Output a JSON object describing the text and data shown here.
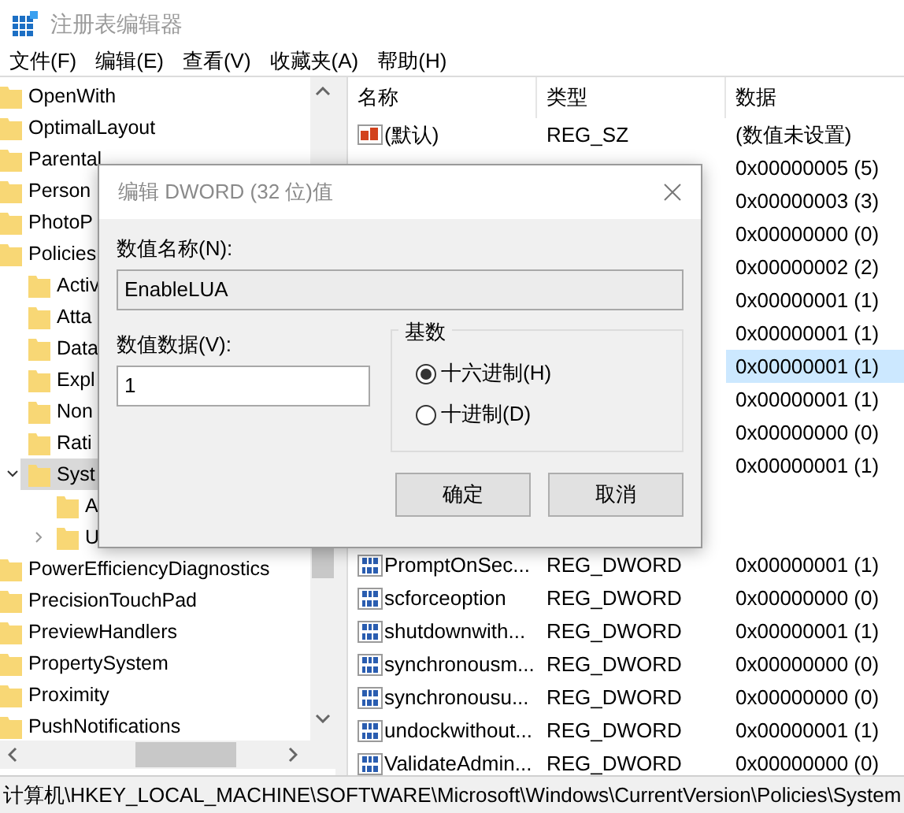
{
  "window": {
    "title": "注册表编辑器"
  },
  "menu": [
    "文件(F)",
    "编辑(E)",
    "查看(V)",
    "收藏夹(A)",
    "帮助(H)"
  ],
  "tree": [
    {
      "label": "OpenWith",
      "selected": false
    },
    {
      "label": "OptimalLayout",
      "selected": false
    },
    {
      "label": "Parental",
      "selected": false
    },
    {
      "label": "Person",
      "selected": false
    },
    {
      "label": "PhotoP",
      "selected": false
    },
    {
      "label": "Policies",
      "selected": false,
      "children": [
        {
          "label": "Activ",
          "selected": false
        },
        {
          "label": "Atta",
          "selected": false
        },
        {
          "label": "Data",
          "selected": false
        },
        {
          "label": "Expl",
          "selected": false
        },
        {
          "label": "Non",
          "selected": false
        },
        {
          "label": "Rati",
          "selected": false
        },
        {
          "label": "Syst",
          "selected": true,
          "expanded": true,
          "children": [
            {
              "label": "A",
              "selected": false
            },
            {
              "label": "U",
              "selected": false,
              "expanded": false
            }
          ]
        }
      ]
    },
    {
      "label": "PowerEfficiencyDiagnostics",
      "selected": false
    },
    {
      "label": "PrecisionTouchPad",
      "selected": false
    },
    {
      "label": "PreviewHandlers",
      "selected": false
    },
    {
      "label": "PropertySystem",
      "selected": false
    },
    {
      "label": "Proximity",
      "selected": false
    },
    {
      "label": "PushNotifications",
      "selected": false
    }
  ],
  "list": {
    "columns": [
      "名称",
      "类型",
      "数据"
    ],
    "rows": [
      {
        "kind": "string",
        "name": "(默认)",
        "type": "REG_SZ",
        "data": "(数值未设置)",
        "selected": false
      },
      {
        "data": "0x00000005 (5)",
        "selected": false
      },
      {
        "data": "0x00000003 (3)",
        "selected": false
      },
      {
        "data": "0x00000000 (0)",
        "selected": false
      },
      {
        "data": "0x00000002 (2)",
        "selected": false
      },
      {
        "data": "0x00000001 (1)",
        "selected": false
      },
      {
        "data": "0x00000001 (1)",
        "selected": false
      },
      {
        "data": "0x00000001 (1)",
        "selected": true
      },
      {
        "data": "0x00000001 (1)",
        "selected": false
      },
      {
        "data": "0x00000000 (0)",
        "selected": false
      },
      {
        "data": "0x00000001 (1)",
        "selected": false
      },
      {
        "selected": false
      },
      {
        "selected": false
      },
      {
        "kind": "dword",
        "name": "PromptOnSec...",
        "type": "REG_DWORD",
        "data": "0x00000001 (1)",
        "selected": false
      },
      {
        "kind": "dword",
        "name": "scforceoption",
        "type": "REG_DWORD",
        "data": "0x00000000 (0)",
        "selected": false
      },
      {
        "kind": "dword",
        "name": "shutdownwith...",
        "type": "REG_DWORD",
        "data": "0x00000001 (1)",
        "selected": false
      },
      {
        "kind": "dword",
        "name": "synchronousm...",
        "type": "REG_DWORD",
        "data": "0x00000000 (0)",
        "selected": false
      },
      {
        "kind": "dword",
        "name": "synchronousu...",
        "type": "REG_DWORD",
        "data": "0x00000000 (0)",
        "selected": false
      },
      {
        "kind": "dword",
        "name": "undockwithout...",
        "type": "REG_DWORD",
        "data": "0x00000001 (1)",
        "selected": false
      },
      {
        "kind": "dword",
        "name": "ValidateAdmin...",
        "type": "REG_DWORD",
        "data": "0x00000000 (0)",
        "selected": false
      }
    ]
  },
  "dialog": {
    "title": "编辑 DWORD (32 位)值",
    "name_label": "数值名称(N):",
    "name_value": "EnableLUA",
    "data_label": "数值数据(V):",
    "data_value": "1",
    "base": {
      "title": "基数",
      "options": [
        {
          "label": "十六进制(H)",
          "selected": true
        },
        {
          "label": "十进制(D)",
          "selected": false
        }
      ]
    },
    "buttons": [
      "确定",
      "取消"
    ]
  },
  "status_bar": "计算机\\HKEY_LOCAL_MACHINE\\SOFTWARE\\Microsoft\\Windows\\CurrentVersion\\Policies\\System"
}
